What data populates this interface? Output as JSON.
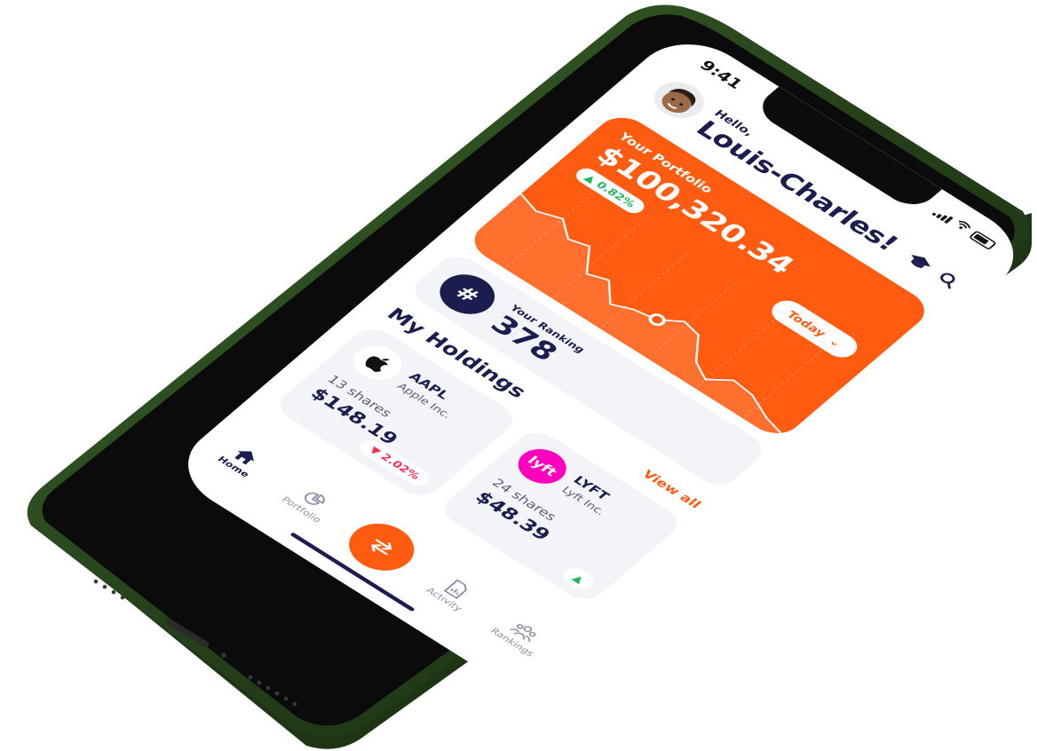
{
  "status_bar": {
    "time": "9:41"
  },
  "header": {
    "greeting": "Hello,",
    "user_name": "Louis-Charles!"
  },
  "portfolio": {
    "label": "Your Portfolio",
    "value": "$100,320.34",
    "change": "0.82%",
    "change_direction": "up",
    "period": "Today",
    "accent_color": "#ff5c12"
  },
  "ranking": {
    "badge_symbol": "#",
    "label": "Your Ranking",
    "value": "378"
  },
  "holdings": {
    "title": "My Holdings",
    "view_all": "View all",
    "items": [
      {
        "ticker": "AAPL",
        "company": "Apple Inc.",
        "shares": "13 shares",
        "price": "$148.19",
        "change": "2.02%",
        "change_direction": "down",
        "logo_icon": "apple-logo-icon",
        "logo_bg": "#ffffff"
      },
      {
        "ticker": "LYFT",
        "company": "Lyft Inc.",
        "shares": "24 shares",
        "price": "$48.39",
        "change": "",
        "change_direction": "up",
        "logo_icon": "lyft-logo-icon",
        "logo_text": "lyft",
        "logo_bg": "#ff00bf"
      }
    ]
  },
  "tab_bar": {
    "tabs": [
      {
        "label": "Home",
        "icon": "home-icon",
        "active": true
      },
      {
        "label": "Portfolio",
        "icon": "pie-chart-icon",
        "active": false
      },
      {
        "label": "",
        "icon": "swap-arrows-icon",
        "active": false
      },
      {
        "label": "Activity",
        "icon": "activity-chart-icon",
        "active": false
      },
      {
        "label": "Rankings",
        "icon": "people-icon",
        "active": false
      }
    ]
  },
  "colors": {
    "navy": "#1c1d4f",
    "orange": "#ff5c12",
    "positive": "#1fb85a",
    "negative": "#ff2d55",
    "phone_frame": "#2e4a20"
  }
}
